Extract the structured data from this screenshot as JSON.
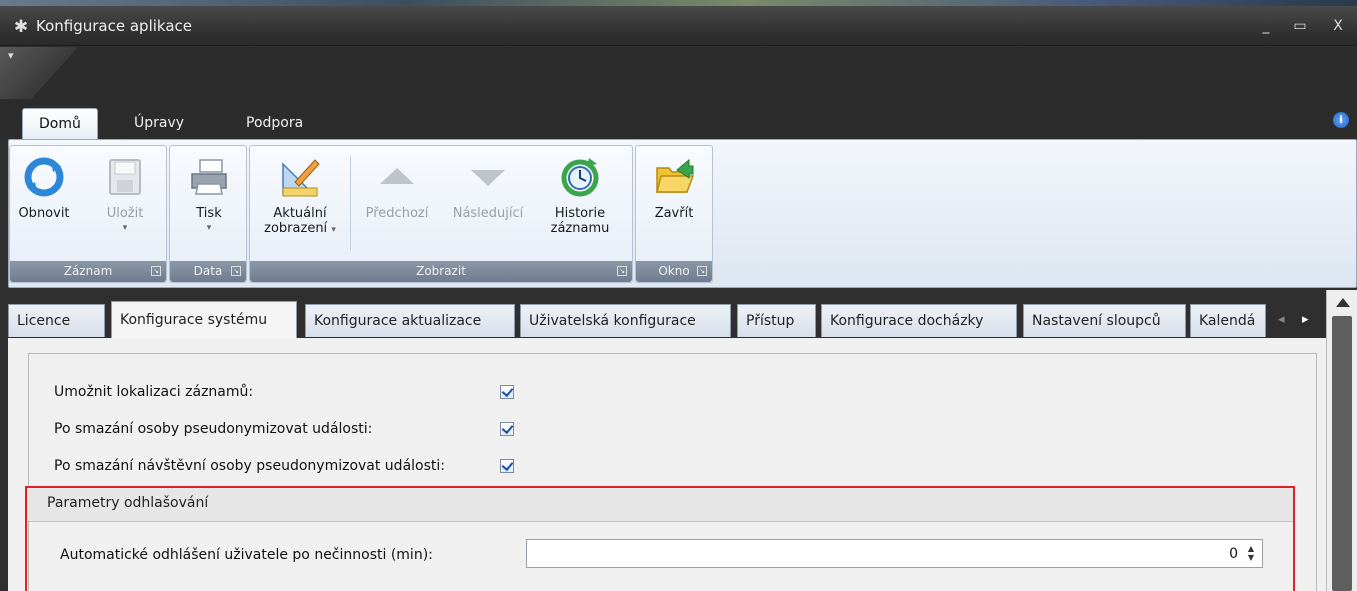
{
  "window": {
    "title": "Konfigurace aplikace",
    "controls": {
      "minimize": "_",
      "maximize": "▭",
      "close": "X"
    }
  },
  "ribbon_tabs": [
    {
      "label": "Domů",
      "active": true
    },
    {
      "label": "Úpravy",
      "active": false
    },
    {
      "label": "Podpora",
      "active": false
    }
  ],
  "ribbon": {
    "groups": {
      "zaznam": "Záznam",
      "data": "Data",
      "zobrazit": "Zobrazit",
      "okno": "Okno"
    },
    "buttons": {
      "obnovit": "Obnovit",
      "ulozit": "Uložit",
      "tisk": "Tisk",
      "aktualni_1": "Aktuální",
      "aktualni_2": "zobrazení",
      "predchozi": "Předchozí",
      "nasledujici": "Následující",
      "historie_1": "Historie",
      "historie_2": "záznamu",
      "zavrit": "Zavřít"
    }
  },
  "content_tabs": [
    {
      "label": "Licence",
      "active": false
    },
    {
      "label": "Konfigurace systému",
      "active": true
    },
    {
      "label": "Konfigurace aktualizace",
      "active": false
    },
    {
      "label": "Uživatelská konfigurace",
      "active": false
    },
    {
      "label": "Přístup",
      "active": false
    },
    {
      "label": "Konfigurace docházky",
      "active": false
    },
    {
      "label": "Nastavení sloupců",
      "active": false
    },
    {
      "label": "Kalendá",
      "active": false
    }
  ],
  "settings": {
    "localization_label": "Umožnit lokalizaci záznamů:",
    "localization_checked": true,
    "pseudonymize_person_label": "Po smazání osoby pseudonymizovat události:",
    "pseudonymize_person_checked": true,
    "pseudonymize_visitor_label": "Po smazání návštěvní osoby pseudonymizovat události:",
    "pseudonymize_visitor_checked": true
  },
  "logout_params": {
    "header": "Parametry odhlašování",
    "auto_logout_label": "Automatické odhlášení uživatele po nečinnosti (min):",
    "auto_logout_value": "0"
  },
  "colors": {
    "highlight_border": "#e0202c",
    "ribbon_bg": "#dde6f1",
    "titlebar_bg": "#333333"
  }
}
